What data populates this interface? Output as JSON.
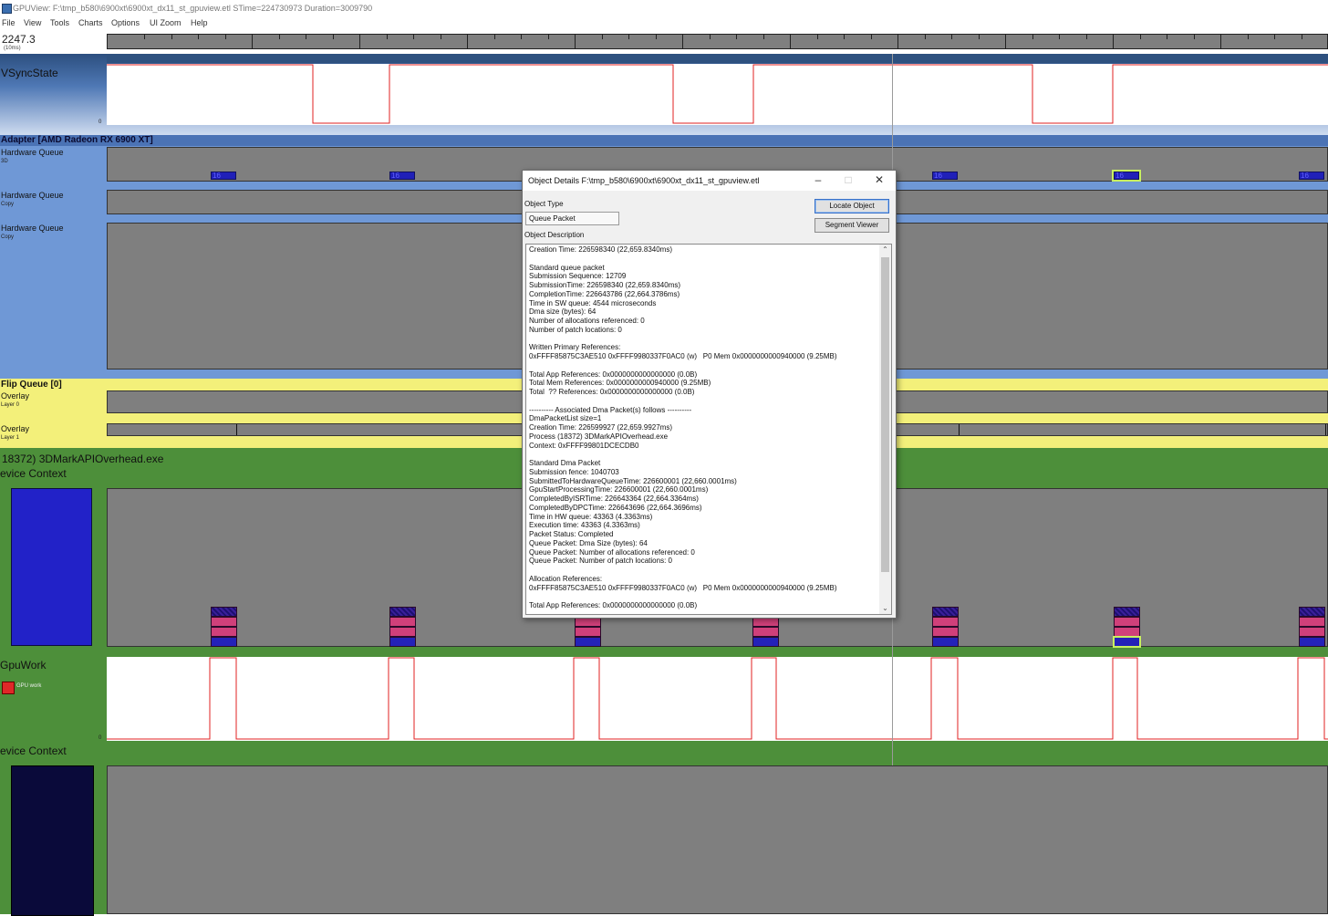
{
  "window": {
    "title": "GPUView: F:\\tmp_b580\\6900xt\\6900xt_dx11_st_gpuview.etl STime=224730973 Duration=3009790"
  },
  "menu": [
    "File",
    "View",
    "Tools",
    "Charts",
    "Options",
    "UI Zoom",
    "Help"
  ],
  "timeline": {
    "readout": "2247.3",
    "unit": "(10ms)"
  },
  "vsync": {
    "label": "VSyncState",
    "axis_zero": "0"
  },
  "adapter": {
    "label": "Adapter [AMD Radeon RX 6900 XT]",
    "queues": [
      {
        "name": "Hardware Queue",
        "sub": "3D"
      },
      {
        "name": "Hardware Queue",
        "sub": "Copy"
      },
      {
        "name": "Hardware Queue",
        "sub": "Copy"
      }
    ],
    "packet_label": "16"
  },
  "flip": {
    "label": "Flip Queue [0]",
    "overlays": [
      {
        "name": "Overlay",
        "sub": "Layer 0"
      },
      {
        "name": "Overlay",
        "sub": "Layer 1"
      }
    ]
  },
  "process": {
    "label": "18372) 3DMarkAPIOverhead.exe",
    "device_context_1": "evice Context",
    "gpuwork": {
      "label": "GpuWork",
      "legend": "GPU work",
      "axis_zero": "0"
    },
    "device_context_2": "evice Context"
  },
  "dialog": {
    "title": "Object Details F:\\tmp_b580\\6900xt\\6900xt_dx11_st_gpuview.etl",
    "object_type_label": "Object Type",
    "object_type_value": "Queue Packet",
    "locate_button": "Locate Object",
    "segment_button": "Segment Viewer",
    "description_label": "Object Description",
    "description_lines": [
      "Creation Time: 226598340 (22,659.8340ms)",
      "",
      "Standard queue packet",
      "Submission Sequence: 12709",
      "SubmissionTime: 226598340 (22,659.8340ms)",
      "CompletionTime: 226643786 (22,664.3786ms)",
      "Time in SW queue: 4544 microseconds",
      "Dma size (bytes): 64",
      "Number of allocations referenced: 0",
      "Number of patch locations: 0",
      "",
      "Written Primary References:",
      "0xFFFF85875C3AE510 0xFFFF9980337F0AC0 (w)   P0 Mem 0x0000000000940000 (9.25MB)",
      "",
      "Total App References: 0x0000000000000000 (0.0B)",
      "Total Mem References: 0x0000000000940000 (9.25MB)",
      "Total  ?? References: 0x0000000000000000 (0.0B)",
      "",
      "---------- Associated Dma Packet(s) follows ----------",
      "DmaPacketList size=1",
      "Creation Time: 226599927 (22,659.9927ms)",
      "Process (18372) 3DMarkAPIOverhead.exe",
      "Context: 0xFFFF99801DCECDB0",
      "",
      "Standard Dma Packet",
      "Submission fence: 1040703",
      "SubmittedToHardwareQueueTime: 226600001 (22,660.0001ms)",
      "GpuStartProcessingTime: 226600001 (22,660.0001ms)",
      "CompletedByISRTime: 226643364 (22,664.3364ms)",
      "CompletedByDPCTime: 226643696 (22,664.3696ms)",
      "Time in HW queue: 43363 (4.3363ms)",
      "Execution time: 43363 (4.3363ms)",
      "Packet Status: Completed",
      "Queue Packet: Dma Size (bytes): 64",
      "Queue Packet: Number of allocations referenced: 0",
      "Queue Packet: Number of patch locations: 0",
      "",
      "Allocation References:",
      "0xFFFF85875C3AE510 0xFFFF9980337F0AC0 (w)   P0 Mem 0x0000000000940000 (9.25MB)",
      "",
      "Total App References: 0x0000000000000000 (0.0B)"
    ]
  },
  "colors": {
    "signal": "#e02020",
    "packet_blue": "#2020b8",
    "packet_pink": "#d0407a",
    "process_green": "#4d8f3a",
    "flip_yellow": "#f3f07a",
    "adapter_blue": "#6f98d6",
    "selection": "#c8f060"
  },
  "icons": [
    "app-icon",
    "minimize-icon",
    "maximize-icon",
    "close-icon",
    "scroll-up-icon",
    "scroll-down-icon"
  ]
}
